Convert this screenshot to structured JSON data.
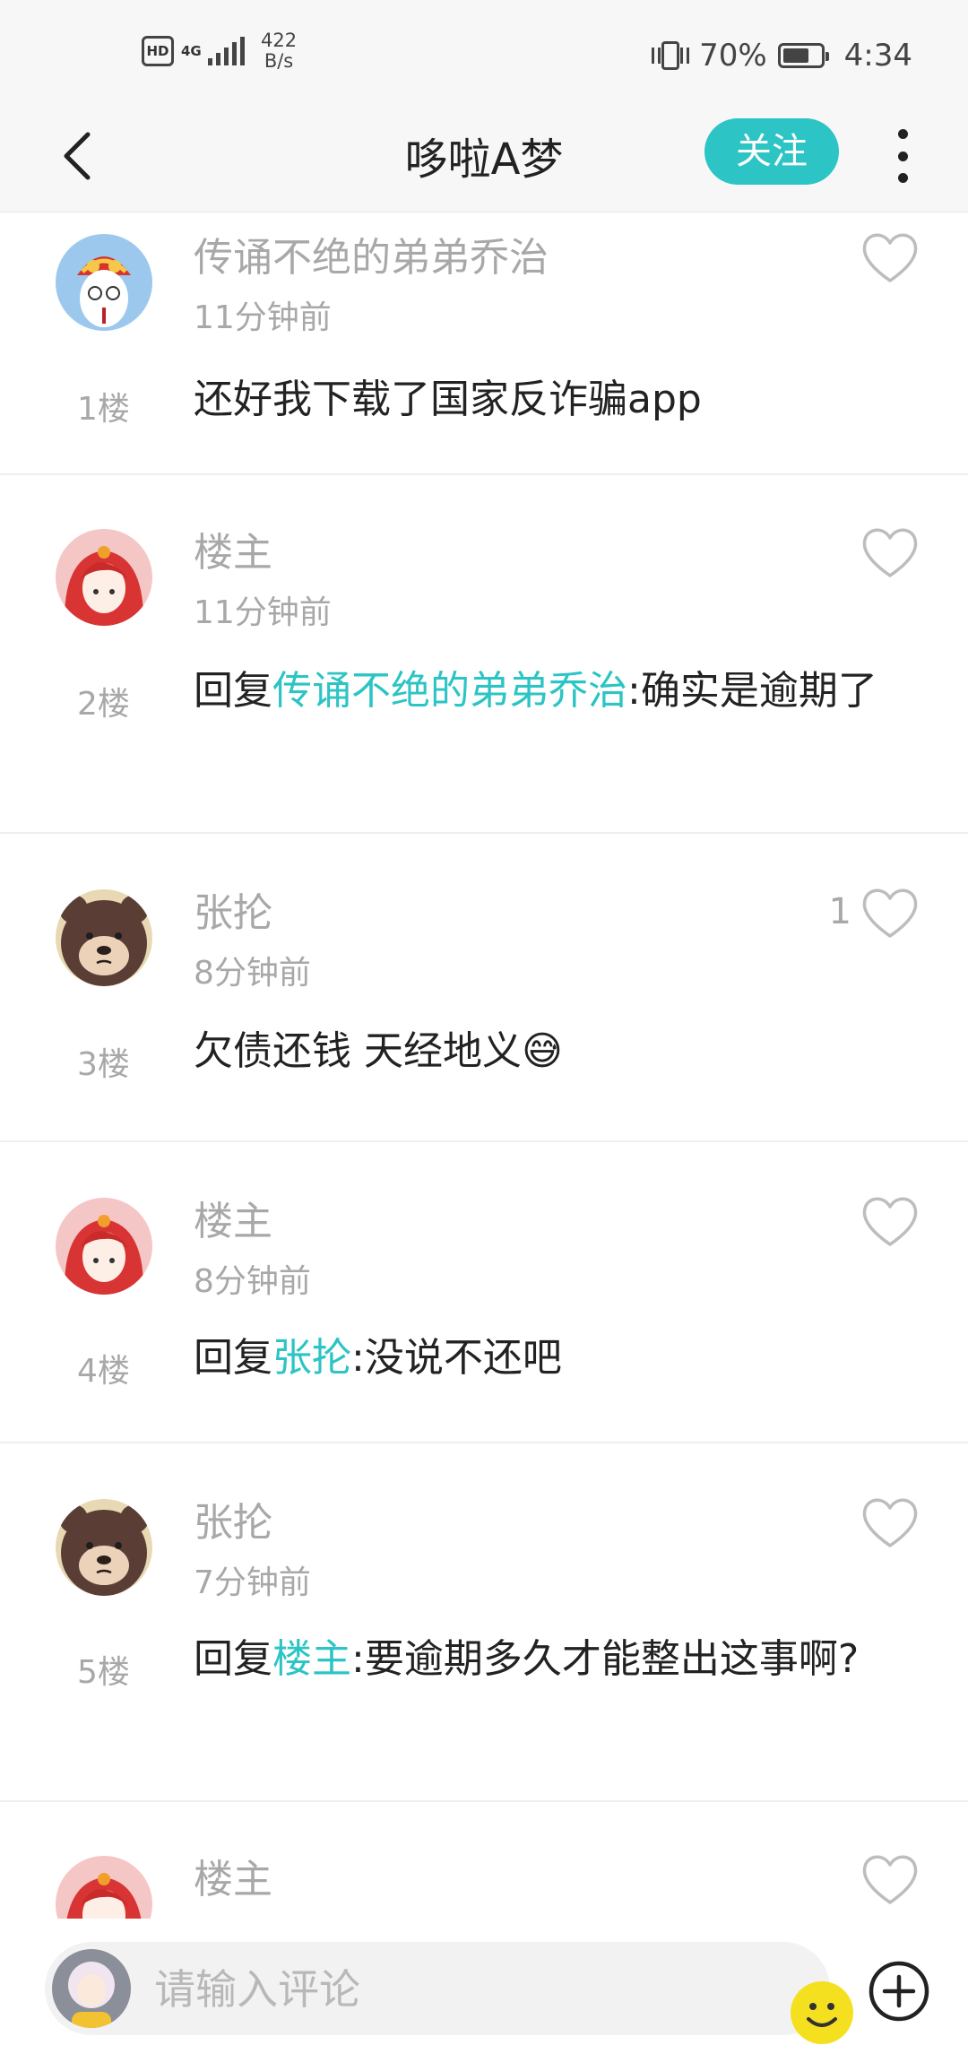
{
  "status_bar": {
    "hd": "HD",
    "network": "4G",
    "speed_value": "422",
    "speed_unit": "B/s",
    "battery": "70%",
    "battery_level": 0.7,
    "time": "4:34"
  },
  "header": {
    "title": "哆啦A梦",
    "follow_label": "关注"
  },
  "comments": [
    {
      "username": "传诵不绝的弟弟乔治",
      "time": "11分钟前",
      "floor": "1楼",
      "likes": "",
      "reply_prefix": "",
      "mention": "",
      "text": "还好我下载了国家反诈骗app"
    },
    {
      "username": "楼主",
      "time": "11分钟前",
      "floor": "2楼",
      "likes": "",
      "reply_prefix": "回复",
      "mention": "传诵不绝的弟弟乔治",
      "text": ":确实是逾期了"
    },
    {
      "username": "张抡",
      "time": "8分钟前",
      "floor": "3楼",
      "likes": "1",
      "reply_prefix": "",
      "mention": "",
      "text": "欠债还钱 天经地义😅"
    },
    {
      "username": "楼主",
      "time": "8分钟前",
      "floor": "4楼",
      "likes": "",
      "reply_prefix": "回复",
      "mention": "张抡",
      "text": ":没说不还吧"
    },
    {
      "username": "张抡",
      "time": "7分钟前",
      "floor": "5楼",
      "likes": "",
      "reply_prefix": "回复",
      "mention": "楼主",
      "text": ":要逾期多久才能整出这事啊?"
    },
    {
      "username": "楼主",
      "time": "",
      "floor": "",
      "likes": "",
      "reply_prefix": "",
      "mention": "",
      "text": ""
    }
  ],
  "bottom_bar": {
    "placeholder": "请输入评论"
  },
  "colors": {
    "accent": "#2cc4c4",
    "muted_text": "#a8a8a8",
    "emoji_button": "#f5e020"
  },
  "icons": [
    "back-arrow-icon",
    "more-vertical-icon",
    "heart-outline-icon",
    "smiley-icon",
    "plus-circle-icon"
  ]
}
